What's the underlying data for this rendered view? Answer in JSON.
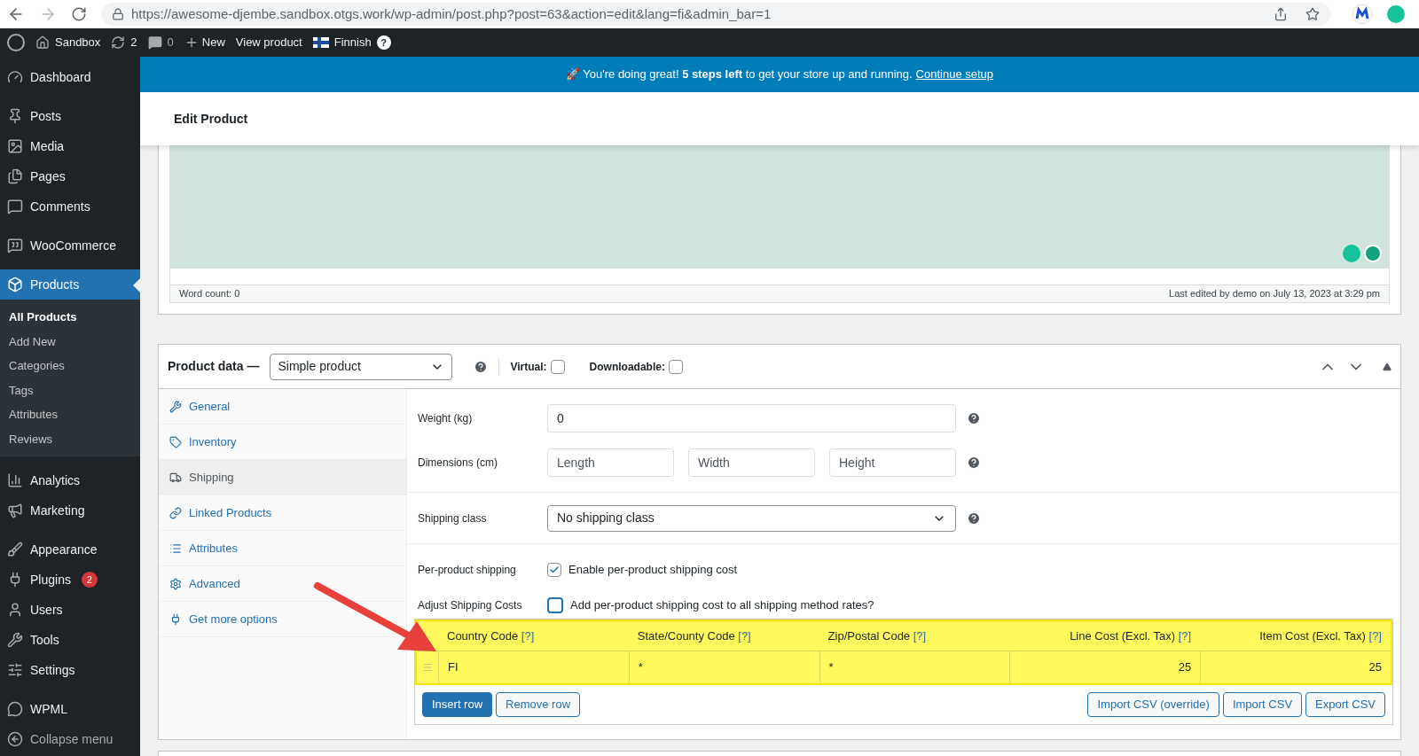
{
  "browser": {
    "url": "https://awesome-djembe.sandbox.otgs.work/wp-admin/post.php?post=63&action=edit&lang=fi&admin_bar=1"
  },
  "admin_bar": {
    "site": "Sandbox",
    "updates": "2",
    "comments": "0",
    "new": "New",
    "view": "View product",
    "language": "Finnish",
    "help": "?"
  },
  "sidebar": {
    "items": [
      {
        "label": "Dashboard",
        "selected": false
      },
      {
        "label": "Posts",
        "selected": false
      },
      {
        "label": "Media",
        "selected": false
      },
      {
        "label": "Pages",
        "selected": false
      },
      {
        "label": "Comments",
        "selected": false
      },
      {
        "label": "WooCommerce",
        "selected": false
      },
      {
        "label": "Products",
        "selected": true,
        "children": [
          {
            "label": "All Products",
            "selected": true
          },
          {
            "label": "Add New",
            "selected": false
          },
          {
            "label": "Categories",
            "selected": false
          },
          {
            "label": "Tags",
            "selected": false
          },
          {
            "label": "Attributes",
            "selected": false
          },
          {
            "label": "Reviews",
            "selected": false
          }
        ]
      },
      {
        "label": "Analytics",
        "selected": false
      },
      {
        "label": "Marketing",
        "selected": false
      },
      {
        "label": "Appearance",
        "selected": false
      },
      {
        "label": "Plugins",
        "selected": false,
        "badge": "2"
      },
      {
        "label": "Users",
        "selected": false
      },
      {
        "label": "Tools",
        "selected": false
      },
      {
        "label": "Settings",
        "selected": false
      },
      {
        "label": "WPML",
        "selected": false
      },
      {
        "label": "Collapse menu",
        "selected": false
      }
    ]
  },
  "notice": {
    "text": "🚀 You're doing great! **5 steps left** to get your store up and running.",
    "link": "Continue setup"
  },
  "page_title": "Edit Product",
  "editor": {
    "word_count": "Word count: 0",
    "last_edited": "Last edited by demo on July 13, 2023 at 3:29 pm"
  },
  "product_data": {
    "title": "Product data —",
    "type": "Simple product",
    "virtual": {
      "label": "Virtual:",
      "checked": false
    },
    "downloadable": {
      "label": "Downloadable:",
      "checked": false
    },
    "tabs": [
      {
        "label": "General",
        "selected": false
      },
      {
        "label": "Inventory",
        "selected": false
      },
      {
        "label": "Shipping",
        "selected": true
      },
      {
        "label": "Linked Products",
        "selected": false
      },
      {
        "label": "Attributes",
        "selected": false
      },
      {
        "label": "Advanced",
        "selected": false
      },
      {
        "label": "Get more options",
        "selected": false
      }
    ],
    "weight": {
      "label": "Weight (kg)",
      "value": "0"
    },
    "dimensions": {
      "label": "Dimensions (cm)",
      "placeholders": [
        "Length",
        "Width",
        "Height"
      ]
    },
    "shipping_class": {
      "label": "Shipping class",
      "value": "No shipping class"
    },
    "per_product": {
      "label": "Per-product shipping",
      "option": "Enable per-product shipping cost",
      "checked": true
    },
    "adjust": {
      "label": "Adjust Shipping Costs",
      "option": "Add per-product shipping cost to all shipping method rates?",
      "checked": false
    },
    "table": {
      "columns": [
        {
          "label": "Country Code",
          "help": "[?]"
        },
        {
          "label": "State/County Code",
          "help": "[?]"
        },
        {
          "label": "Zip/Postal Code",
          "help": "[?]"
        },
        {
          "label": "Line Cost (Excl. Tax)",
          "help": "[?]"
        },
        {
          "label": "Item Cost (Excl. Tax)",
          "help": "[?]"
        }
      ],
      "rows": [
        [
          "FI",
          "*",
          "*",
          "25",
          "25"
        ]
      ]
    },
    "buttons": [
      "Insert row",
      "Remove row"
    ],
    "csv_buttons": [
      "Import CSV (override)",
      "Import CSV",
      "Export CSV"
    ]
  }
}
